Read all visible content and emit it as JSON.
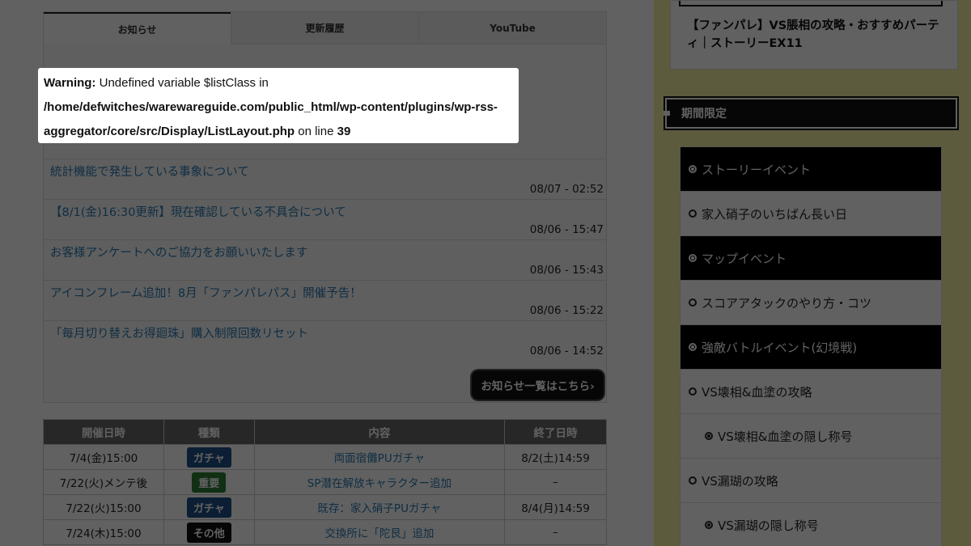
{
  "tabs": [
    "お知らせ",
    "更新履歴",
    "YouTube"
  ],
  "warning": {
    "label": "Warning:",
    "message": " Undefined variable $listClass in ",
    "path": "/home/defwitches/warewareguide.com/public_html/wp-content/plugins/wp-rss-aggregator/core/src/Display/ListLayout.php",
    "on_line": " on line ",
    "line": "39"
  },
  "news": [
    {
      "title": "統計機能で発生している事象について",
      "date": "08/07 - 02:52"
    },
    {
      "title": "【8/1(金)16:30更新】現在確認している不具合について",
      "date": "08/06 - 15:47"
    },
    {
      "title": "お客様アンケートへのご協力をお願いいたします",
      "date": "08/06 - 15:43"
    },
    {
      "title": "アイコンフレーム追加！8月「ファンパレパス」開催予告！",
      "date": "08/06 - 15:22"
    },
    {
      "title": "「毎月切り替えお得廻珠」購入制限回数リセット",
      "date": "08/06 - 14:52"
    }
  ],
  "more_button": "お知らせ一覧はこちら›",
  "events": {
    "headers": [
      "開催日時",
      "種類",
      "内容",
      "終了日時"
    ],
    "rows": [
      {
        "start": "7/4(金)15:00",
        "type": "ガチャ",
        "color": "#1e4f86",
        "content": "両面宿儺PUガチャ",
        "end": "8/2(土)14:59"
      },
      {
        "start": "7/22(火)メンテ後",
        "type": "重要",
        "color": "#2e7d32",
        "content": "SP潜在解放キャラクター追加",
        "end": "–"
      },
      {
        "start": "7/22(火)15:00",
        "type": "ガチャ",
        "color": "#1e4f86",
        "content": "既存：家入硝子PUガチャ",
        "end": "8/4(月)14:59"
      },
      {
        "start": "7/24(木)15:00",
        "type": "その他",
        "color": "#111111",
        "content": "交換所に「陀艮」追加",
        "end": "–"
      }
    ]
  },
  "sidebar": {
    "top_article": "【ファンパレ】VS脹相の攻略・おすすめパーティ｜ストーリーEX11",
    "section_title": "期間限定",
    "menu": [
      {
        "label": "ストーリーイベント",
        "kind": "cat"
      },
      {
        "label": "家入硝子のいちばん長い日",
        "kind": "item"
      },
      {
        "label": "マップイベント",
        "kind": "cat"
      },
      {
        "label": "スコアアタックのやり方・コツ",
        "kind": "item"
      },
      {
        "label": "強敵バトルイベント(幻境戦)",
        "kind": "cat"
      },
      {
        "label": "VS壊相&血塗の攻略",
        "kind": "item"
      },
      {
        "label": "VS壊相&血塗の隠し称号",
        "kind": "sub"
      },
      {
        "label": "VS漏瑚の攻略",
        "kind": "item"
      },
      {
        "label": "VS漏瑚の隠し称号",
        "kind": "sub"
      }
    ]
  }
}
